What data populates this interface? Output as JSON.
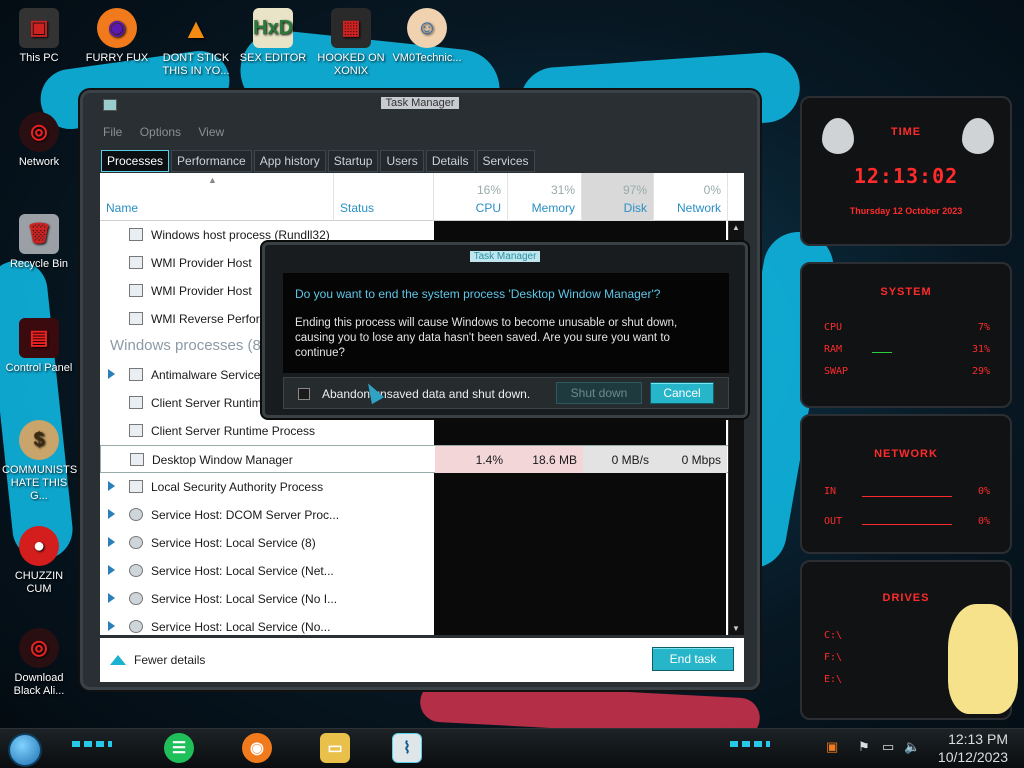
{
  "desktop": {
    "icons_top": [
      {
        "label": "This PC"
      },
      {
        "label": "FURRY FUX"
      },
      {
        "label": "DONT STICK THIS IN YO..."
      },
      {
        "label": "SEX EDITOR"
      },
      {
        "label": "HOOKED ON XONIX"
      },
      {
        "label": "VM0Technic..."
      }
    ],
    "icons_left": [
      {
        "label": "Network"
      },
      {
        "label": "Recycle Bin"
      },
      {
        "label": "Control Panel"
      },
      {
        "label": "COMMUNISTS HATE THIS G..."
      },
      {
        "label": "CHUZZIN CUM"
      },
      {
        "label": "Download Black Ali..."
      }
    ]
  },
  "taskmanager": {
    "title": "Task Manager",
    "menu": [
      "File",
      "Options",
      "View"
    ],
    "tabs": [
      "Processes",
      "Performance",
      "App history",
      "Startup",
      "Users",
      "Details",
      "Services"
    ],
    "columns": {
      "name": "Name",
      "status": "Status",
      "cpu_pct": "16%",
      "cpu": "CPU",
      "memory_pct": "31%",
      "memory": "Memory",
      "disk_pct": "97%",
      "disk": "Disk",
      "network_pct": "0%",
      "network": "Network"
    },
    "rows_top": [
      {
        "name": "Windows host process (Rundll32)"
      },
      {
        "name": "WMI Provider Host"
      },
      {
        "name": "WMI Provider Host"
      },
      {
        "name": "WMI Reverse Perform"
      }
    ],
    "group_title": "Windows processes (8",
    "rows_windows": [
      {
        "name": "Antimalware Service E"
      },
      {
        "name": "Client Server Runtime"
      },
      {
        "name": "Client Server Runtime Process"
      }
    ],
    "selected": {
      "name": "Desktop Window Manager",
      "cpu": "1.4%",
      "memory": "18.6 MB",
      "disk": "0 MB/s",
      "network": "0 Mbps"
    },
    "rows_bottom": [
      {
        "name": "Local Security Authority Process"
      },
      {
        "name": "Service Host: DCOM Server Proc..."
      },
      {
        "name": "Service Host: Local Service (8)"
      },
      {
        "name": "Service Host: Local Service (Net..."
      },
      {
        "name": "Service Host: Local Service (No I..."
      },
      {
        "name": "Service Host: Local Service (No..."
      }
    ],
    "fewer_details": "Fewer details",
    "end_task": "End task"
  },
  "dialog": {
    "title": "Task Manager",
    "question": "Do you want to end the system process 'Desktop Window Manager'?",
    "message": "Ending this process will cause Windows to become unusable or shut down, causing you to lose any data hasn't been saved. Are you sure you want to continue?",
    "checkbox_label": "Abandon unsaved data and shut down.",
    "shutdown_button": "Shut down",
    "cancel_button": "Cancel"
  },
  "widgets": {
    "time": {
      "title": "TIME",
      "clock": "12:13:02",
      "date": "Thursday 12 October 2023"
    },
    "system": {
      "title": "SYSTEM",
      "rows": [
        {
          "label": "CPU",
          "value": "7%"
        },
        {
          "label": "RAM",
          "value": "31%"
        },
        {
          "label": "SWAP",
          "value": "29%"
        }
      ]
    },
    "network": {
      "title": "NETWORK",
      "rows": [
        {
          "label": "IN",
          "value": "0%"
        },
        {
          "label": "OUT",
          "value": "0%"
        }
      ]
    },
    "drives": {
      "title": "DRIVES",
      "rows": [
        {
          "label": "C:\\"
        },
        {
          "label": "F:\\"
        },
        {
          "label": "E:\\"
        }
      ]
    }
  },
  "taskbar": {
    "time": "12:13 PM",
    "date": "10/12/2023"
  },
  "colors": {
    "accent": "#27b6c9",
    "widget_red": "#ff2b2b",
    "link_blue": "#2a8fc4"
  }
}
